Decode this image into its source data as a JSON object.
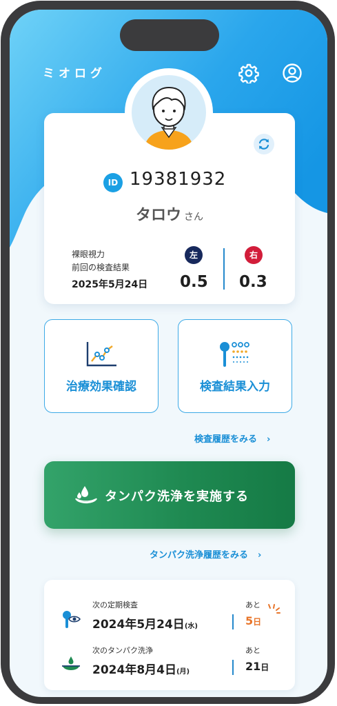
{
  "app": {
    "title": "ミオログ"
  },
  "header": {
    "settings_icon": "gear-icon",
    "profile_icon": "user-circle-icon"
  },
  "profile": {
    "id_badge": "ID",
    "id_number": "19381932",
    "name": "タロウ",
    "honorific": "さん",
    "sync_icon": "refresh-icon"
  },
  "vision": {
    "label_line1": "裸眼視力",
    "label_line2": "前回の検査結果",
    "date": "2025年5月24日",
    "left_label": "左",
    "left_value": "0.5",
    "right_label": "右",
    "right_value": "0.3",
    "colors": {
      "left": "#17295c",
      "right": "#d21d3a"
    }
  },
  "actions": {
    "treatment": {
      "label": "治療効果確認",
      "icon": "line-chart-icon"
    },
    "input": {
      "label": "検査結果入力",
      "icon": "eye-chart-icon"
    }
  },
  "links": {
    "exam_history": "検査履歴をみる",
    "cleaning_history": "タンパク洗浄履歴をみる"
  },
  "cta": {
    "label": "タンパク洗浄を実施する",
    "icon": "lens-water-drop-icon"
  },
  "schedule": {
    "exam": {
      "label": "次の定期検査",
      "date": "2024年5月24日",
      "weekday": "(水)",
      "remaining_label": "あと",
      "days": "5",
      "unit": "日",
      "icon": "eye-test-icon"
    },
    "cleaning": {
      "label": "次のタンパク洗浄",
      "date": "2024年8月4日",
      "weekday": "(月)",
      "remaining_label": "あと",
      "days": "21",
      "unit": "日",
      "icon": "lens-drop-icon"
    }
  },
  "colors": {
    "accent": "#1a8fd6",
    "primary_green": "#1f8a52",
    "alert": "#e8752a"
  }
}
